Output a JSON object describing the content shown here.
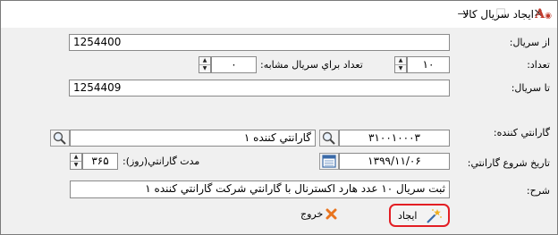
{
  "window": {
    "title": "ايجاد سريال كالا",
    "logo_text": "A",
    "controls": {
      "minimize": "—",
      "maximize": "☐",
      "close": "✕"
    }
  },
  "form": {
    "from_serial": {
      "label": "از سريال:",
      "value": "1254400"
    },
    "count": {
      "label": "تعداد:",
      "value": "۱۰"
    },
    "similar_count": {
      "label": "تعداد براي سريال مشابه:",
      "value": "۰"
    },
    "to_serial": {
      "label": "تا سريال:",
      "value": "1254409"
    },
    "guarantor": {
      "label": "گارانتي كننده:",
      "code": "۳۱۰۰۱۰۰۰۳",
      "name": "گارانتي كننده ۱"
    },
    "guarantee_start": {
      "label": "تاريخ شروع گارانتي:",
      "value": "۱۳۹۹/۱۱/۰۶"
    },
    "guarantee_period": {
      "label": "مدت گارانتي(روز):",
      "value": "۳۶۵"
    },
    "description": {
      "label": "شرح:",
      "value": "ثبت سريال ۱۰ عدد هارد اكسترنال با گارانتي شركت گارانتي كننده ۱"
    }
  },
  "buttons": {
    "create": {
      "label": "ايجاد",
      "icon": "magic-wand-icon"
    },
    "exit": {
      "label": "خروج",
      "icon": "close-x-icon"
    }
  },
  "colors": {
    "highlight": "#e31e24",
    "exit_icon": "#e8741e",
    "logo": "#c0392b"
  }
}
